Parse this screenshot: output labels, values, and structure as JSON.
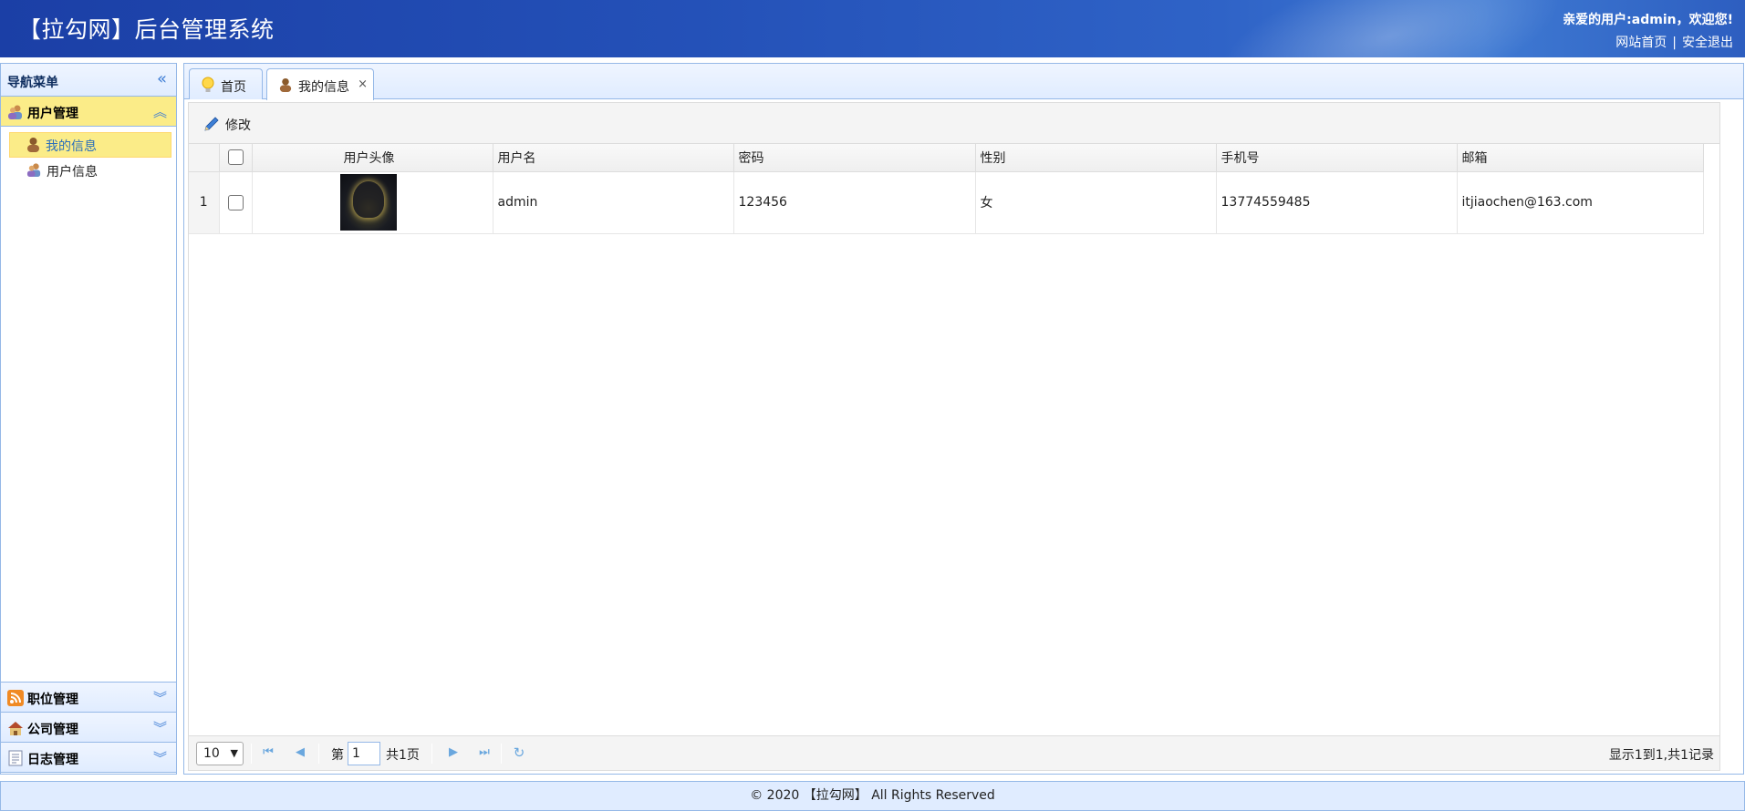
{
  "header": {
    "title": "【拉勾网】后台管理系统",
    "welcome": "亲爱的用户:admin，欢迎您!",
    "home_link": "网站首页",
    "separator": "|",
    "logout_link": "安全退出"
  },
  "sidebar": {
    "title": "导航菜单",
    "collapse_icon": "double-chevron-left-icon",
    "sections": [
      {
        "label": "用户管理",
        "icon": "users-icon",
        "expanded": true
      },
      {
        "label": "职位管理",
        "icon": "rss-icon",
        "expanded": false
      },
      {
        "label": "公司管理",
        "icon": "house-icon",
        "expanded": false
      },
      {
        "label": "日志管理",
        "icon": "log-icon",
        "expanded": false
      }
    ],
    "user_items": [
      {
        "label": "我的信息",
        "icon": "user-icon",
        "selected": true
      },
      {
        "label": "用户信息",
        "icon": "users-icon",
        "selected": false
      }
    ]
  },
  "tabs": [
    {
      "label": "首页",
      "icon": "lightbulb-icon",
      "active": false
    },
    {
      "label": "我的信息",
      "icon": "user-icon",
      "active": true,
      "close": "×"
    }
  ],
  "toolbar": {
    "edit_label": "修改",
    "edit_icon": "pencil-icon"
  },
  "grid": {
    "columns": [
      "用户头像",
      "用户名",
      "密码",
      "性别",
      "手机号",
      "邮箱"
    ],
    "rows": [
      {
        "row_number": "1",
        "username": "admin",
        "password": "123456",
        "gender": "女",
        "phone": "13774559485",
        "email": "itjiaochen@163.com"
      }
    ]
  },
  "pager": {
    "page_size": "10",
    "page_prefix": "第",
    "page_value": "1",
    "page_suffix": "共1页",
    "info": "显示1到1,共1记录"
  },
  "footer": {
    "text": "© 2020 【拉勾网】 All Rights Reserved"
  },
  "colors": {
    "header_blue": "#2451b8",
    "panel_border": "#95b8e7",
    "selected_bg": "#fbec88"
  }
}
